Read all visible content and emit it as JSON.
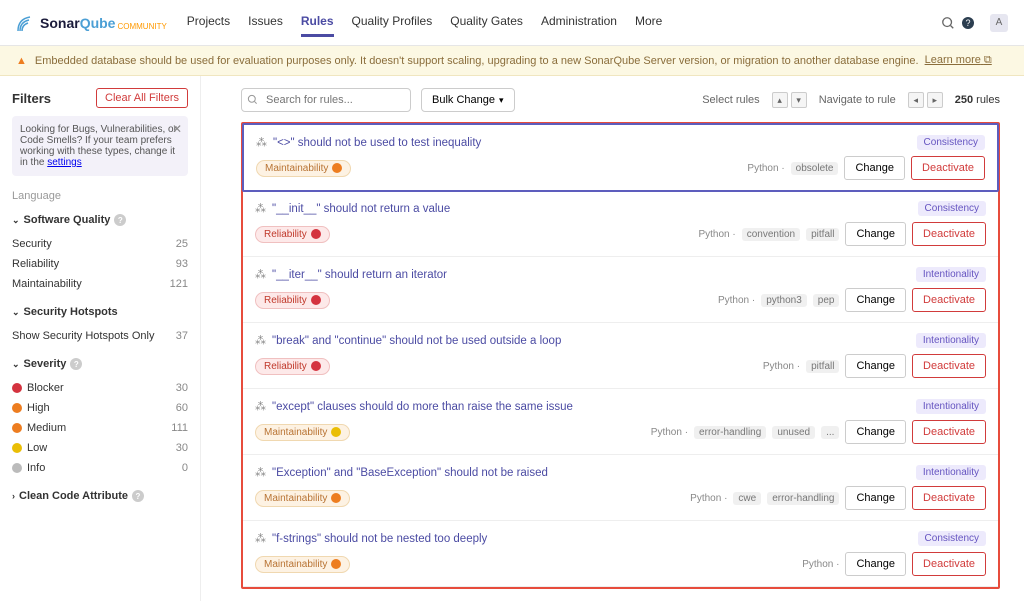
{
  "header": {
    "logo_sonar": "Sonar",
    "logo_qube": "Qube",
    "logo_community": "COMMUNITY",
    "nav": [
      "Projects",
      "Issues",
      "Rules",
      "Quality Profiles",
      "Quality Gates",
      "Administration",
      "More"
    ],
    "active_nav": "Rules",
    "avatar_letter": "A"
  },
  "banner": {
    "text": "Embedded database should be used for evaluation purposes only. It doesn't support scaling, upgrading to a new SonarQube Server version, or migration to another database engine.",
    "link": "Learn more"
  },
  "sidebar": {
    "title": "Filters",
    "clear": "Clear All Filters",
    "info": "Looking for Bugs, Vulnerabilities, or Code Smells? If your team prefers working with these types, change it in the ",
    "info_link": "settings",
    "language_label": "Language",
    "quality": {
      "title": "Software Quality",
      "items": [
        {
          "label": "Security",
          "count": "25"
        },
        {
          "label": "Reliability",
          "count": "93"
        },
        {
          "label": "Maintainability",
          "count": "121"
        }
      ]
    },
    "hotspots": {
      "title": "Security Hotspots",
      "item": "Show Security Hotspots Only",
      "count": "37"
    },
    "severity": {
      "title": "Severity",
      "items": [
        {
          "label": "Blocker",
          "count": "30",
          "color": "#d4333f"
        },
        {
          "label": "High",
          "count": "60",
          "color": "#ed7d20"
        },
        {
          "label": "Medium",
          "count": "111",
          "color": "#ed7d20"
        },
        {
          "label": "Low",
          "count": "30",
          "color": "#eabe06"
        },
        {
          "label": "Info",
          "count": "0",
          "color": "#bbb"
        }
      ]
    },
    "clean_code": "Clean Code Attribute"
  },
  "toolbar": {
    "search_placeholder": "Search for rules...",
    "bulk_change": "Bulk Change",
    "select_rules": "Select rules",
    "navigate": "Navigate to rule",
    "total_count": "250",
    "total_label": "rules"
  },
  "labels": {
    "change": "Change",
    "deactivate": "Deactivate"
  },
  "rules": [
    {
      "title": "\"<>\" should not be used to test inequality",
      "badge": "Consistency",
      "pill": "Maintainability",
      "pill_class": "maint",
      "pill_sev_color": "#ed7d20",
      "lang": "Python",
      "tags": [
        "obsolete"
      ],
      "selected": true
    },
    {
      "title": "\"__init__\" should not return a value",
      "badge": "Consistency",
      "pill": "Reliability",
      "pill_class": "reliab",
      "pill_sev_color": "#d4333f",
      "lang": "Python",
      "tags": [
        "convention",
        "pitfall"
      ]
    },
    {
      "title": "\"__iter__\" should return an iterator",
      "badge": "Intentionality",
      "pill": "Reliability",
      "pill_class": "reliab",
      "pill_sev_color": "#d4333f",
      "lang": "Python",
      "tags": [
        "python3",
        "pep"
      ]
    },
    {
      "title": "\"break\" and \"continue\" should not be used outside a loop",
      "badge": "Intentionality",
      "pill": "Reliability",
      "pill_class": "reliab",
      "pill_sev_color": "#d4333f",
      "lang": "Python",
      "tags": [
        "pitfall"
      ]
    },
    {
      "title": "\"except\" clauses should do more than raise the same issue",
      "badge": "Intentionality",
      "pill": "Maintainability",
      "pill_class": "maint",
      "pill_sev_color": "#eabe06",
      "lang": "Python",
      "tags": [
        "error-handling",
        "unused",
        "..."
      ]
    },
    {
      "title": "\"Exception\" and \"BaseException\" should not be raised",
      "badge": "Intentionality",
      "pill": "Maintainability",
      "pill_class": "maint",
      "pill_sev_color": "#ed7d20",
      "lang": "Python",
      "tags": [
        "cwe",
        "error-handling"
      ]
    },
    {
      "title": "\"f-strings\" should not be nested too deeply",
      "badge": "Consistency",
      "pill": "Maintainability",
      "pill_class": "maint",
      "pill_sev_color": "#ed7d20",
      "lang": "Python",
      "tags": []
    }
  ]
}
